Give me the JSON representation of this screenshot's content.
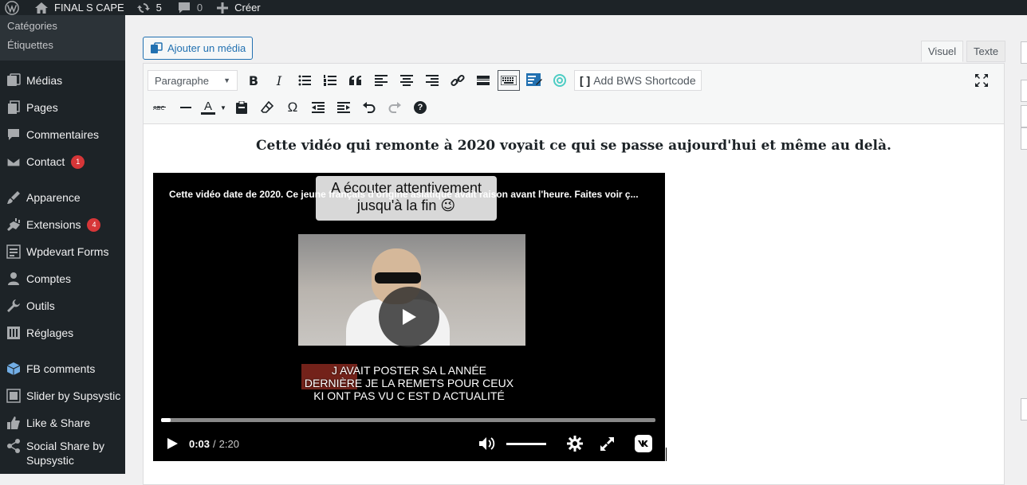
{
  "adminbar": {
    "site_name": "FINAL S CAPE",
    "updates_count": "5",
    "comments_count": "0",
    "new_label": "Créer"
  },
  "sidebar": {
    "submenu": [
      "Catégories",
      "Étiquettes"
    ],
    "items": [
      {
        "label": "Médias",
        "icon": "media-icon"
      },
      {
        "label": "Pages",
        "icon": "pages-icon"
      },
      {
        "label": "Commentaires",
        "icon": "comments-icon"
      },
      {
        "label": "Contact",
        "icon": "mail-icon",
        "badge": "1"
      },
      {
        "label": "Apparence",
        "icon": "appearance-icon"
      },
      {
        "label": "Extensions",
        "icon": "plugins-icon",
        "badge": "4"
      },
      {
        "label": "Wpdevart Forms",
        "icon": "forms-icon"
      },
      {
        "label": "Comptes",
        "icon": "users-icon"
      },
      {
        "label": "Outils",
        "icon": "tools-icon"
      },
      {
        "label": "Réglages",
        "icon": "settings-icon"
      },
      {
        "label": "FB comments",
        "icon": "cube-icon"
      },
      {
        "label": "Slider by Supsystic",
        "icon": "slider-icon"
      },
      {
        "label": "Like & Share",
        "icon": "thumbs-up-icon"
      },
      {
        "label": "Social Share by Supsystic",
        "icon": "share-icon"
      }
    ]
  },
  "editor": {
    "add_media_label": "Ajouter un média",
    "tab_visual": "Visuel",
    "tab_text": "Texte",
    "format_select_value": "Paragraphe",
    "bws_shortcode_label": "Add BWS Shortcode",
    "toolbar_glyphs": {
      "bold": "B",
      "italic": "I",
      "text_color": "A",
      "omega": "Ω",
      "help": "?"
    },
    "post_heading": "Cette vidéo qui remonte à 2020 voyait ce qui se passe aujourd'hui et même au delà."
  },
  "video": {
    "title": "Cette vidéo date de 2020. Ce jeune français d'origine asiatique avait raison avant l'heure. Faites voir ç...",
    "caption_top_line1": "A écouter attentivement",
    "caption_top_line2": "jusqu'à la fin 😉",
    "caption_bottom": "J AVAIT POSTER SA L ANNÉE DERNIÈRE JE LA REMETS POUR CEUX KI ONT PAS VU C EST D ACTUALITÉ",
    "time_current": "0:03",
    "time_separator": "/",
    "time_total": "2:20",
    "progress": 0.02
  },
  "colors": {
    "adminbar_bg": "#1d2327",
    "accent": "#2271b1",
    "badge": "#d63638"
  }
}
